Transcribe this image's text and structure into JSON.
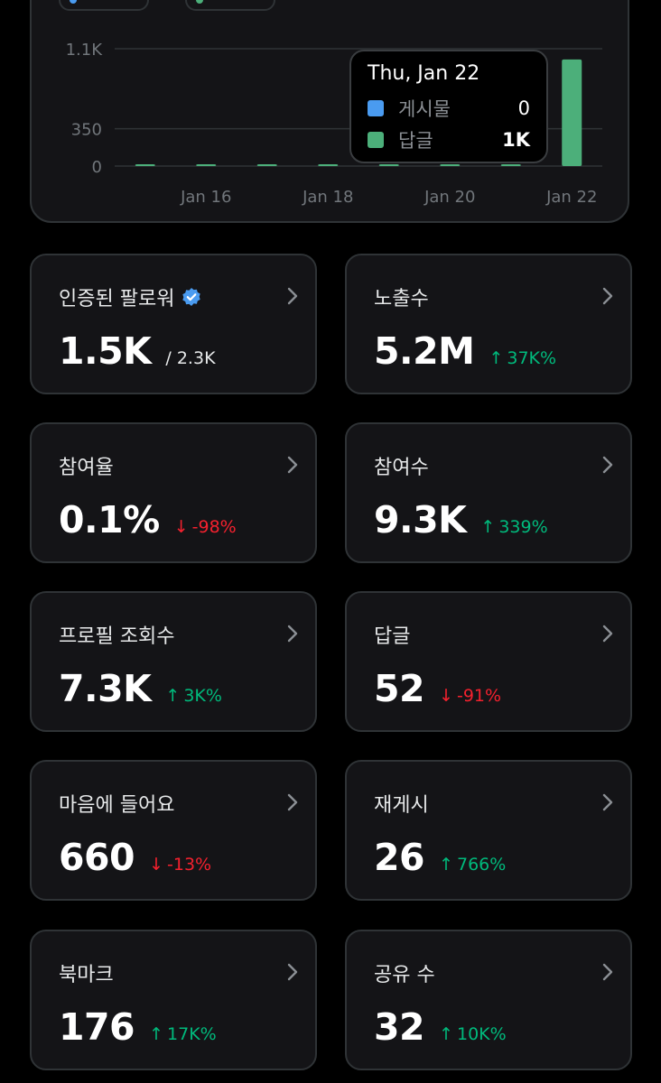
{
  "colors": {
    "posts": "#4a9bf0",
    "replies": "#4caf7a",
    "up": "#00ba7c",
    "down": "#f4212e",
    "verified": "#4a9bf0"
  },
  "chart_data": {
    "type": "bar",
    "categories": [
      "Jan 15",
      "Jan 16",
      "Jan 17",
      "Jan 18",
      "Jan 19",
      "Jan 20",
      "Jan 21",
      "Jan 22"
    ],
    "series": [
      {
        "name": "게시물",
        "values": [
          0,
          0,
          0,
          0,
          0,
          0,
          0,
          0
        ]
      },
      {
        "name": "답글",
        "values": [
          0,
          4,
          8,
          3,
          10,
          12,
          6,
          1000
        ]
      }
    ],
    "y_ticks": [
      "1.1K",
      "350",
      "0"
    ],
    "y_tick_values": [
      1100,
      350,
      0
    ],
    "x_ticks": [
      "Jan 16",
      "Jan 18",
      "Jan 20",
      "Jan 22"
    ],
    "ylim": [
      0,
      1100
    ],
    "grid": true
  },
  "tooltip": {
    "date": "Thu, Jan 22",
    "rows": [
      {
        "label": "게시물",
        "value": "0"
      },
      {
        "label": "답글",
        "value": "1K"
      }
    ]
  },
  "stats": [
    {
      "title": "인증된 팔로워",
      "value": "1.5K",
      "sub": "/ 2.3K",
      "verified": true
    },
    {
      "title": "노출수",
      "value": "5.2M",
      "change": "37K%",
      "dir": "up"
    },
    {
      "title": "참여율",
      "value": "0.1%",
      "change": "-98%",
      "dir": "down"
    },
    {
      "title": "참여수",
      "value": "9.3K",
      "change": "339%",
      "dir": "up"
    },
    {
      "title": "프로필 조회수",
      "value": "7.3K",
      "change": "3K%",
      "dir": "up"
    },
    {
      "title": "답글",
      "value": "52",
      "change": "-91%",
      "dir": "down"
    },
    {
      "title": "마음에 들어요",
      "value": "660",
      "change": "-13%",
      "dir": "down"
    },
    {
      "title": "재게시",
      "value": "26",
      "change": "766%",
      "dir": "up"
    },
    {
      "title": "북마크",
      "value": "176",
      "change": "17K%",
      "dir": "up"
    },
    {
      "title": "공유 수",
      "value": "32",
      "change": "10K%",
      "dir": "up"
    }
  ]
}
